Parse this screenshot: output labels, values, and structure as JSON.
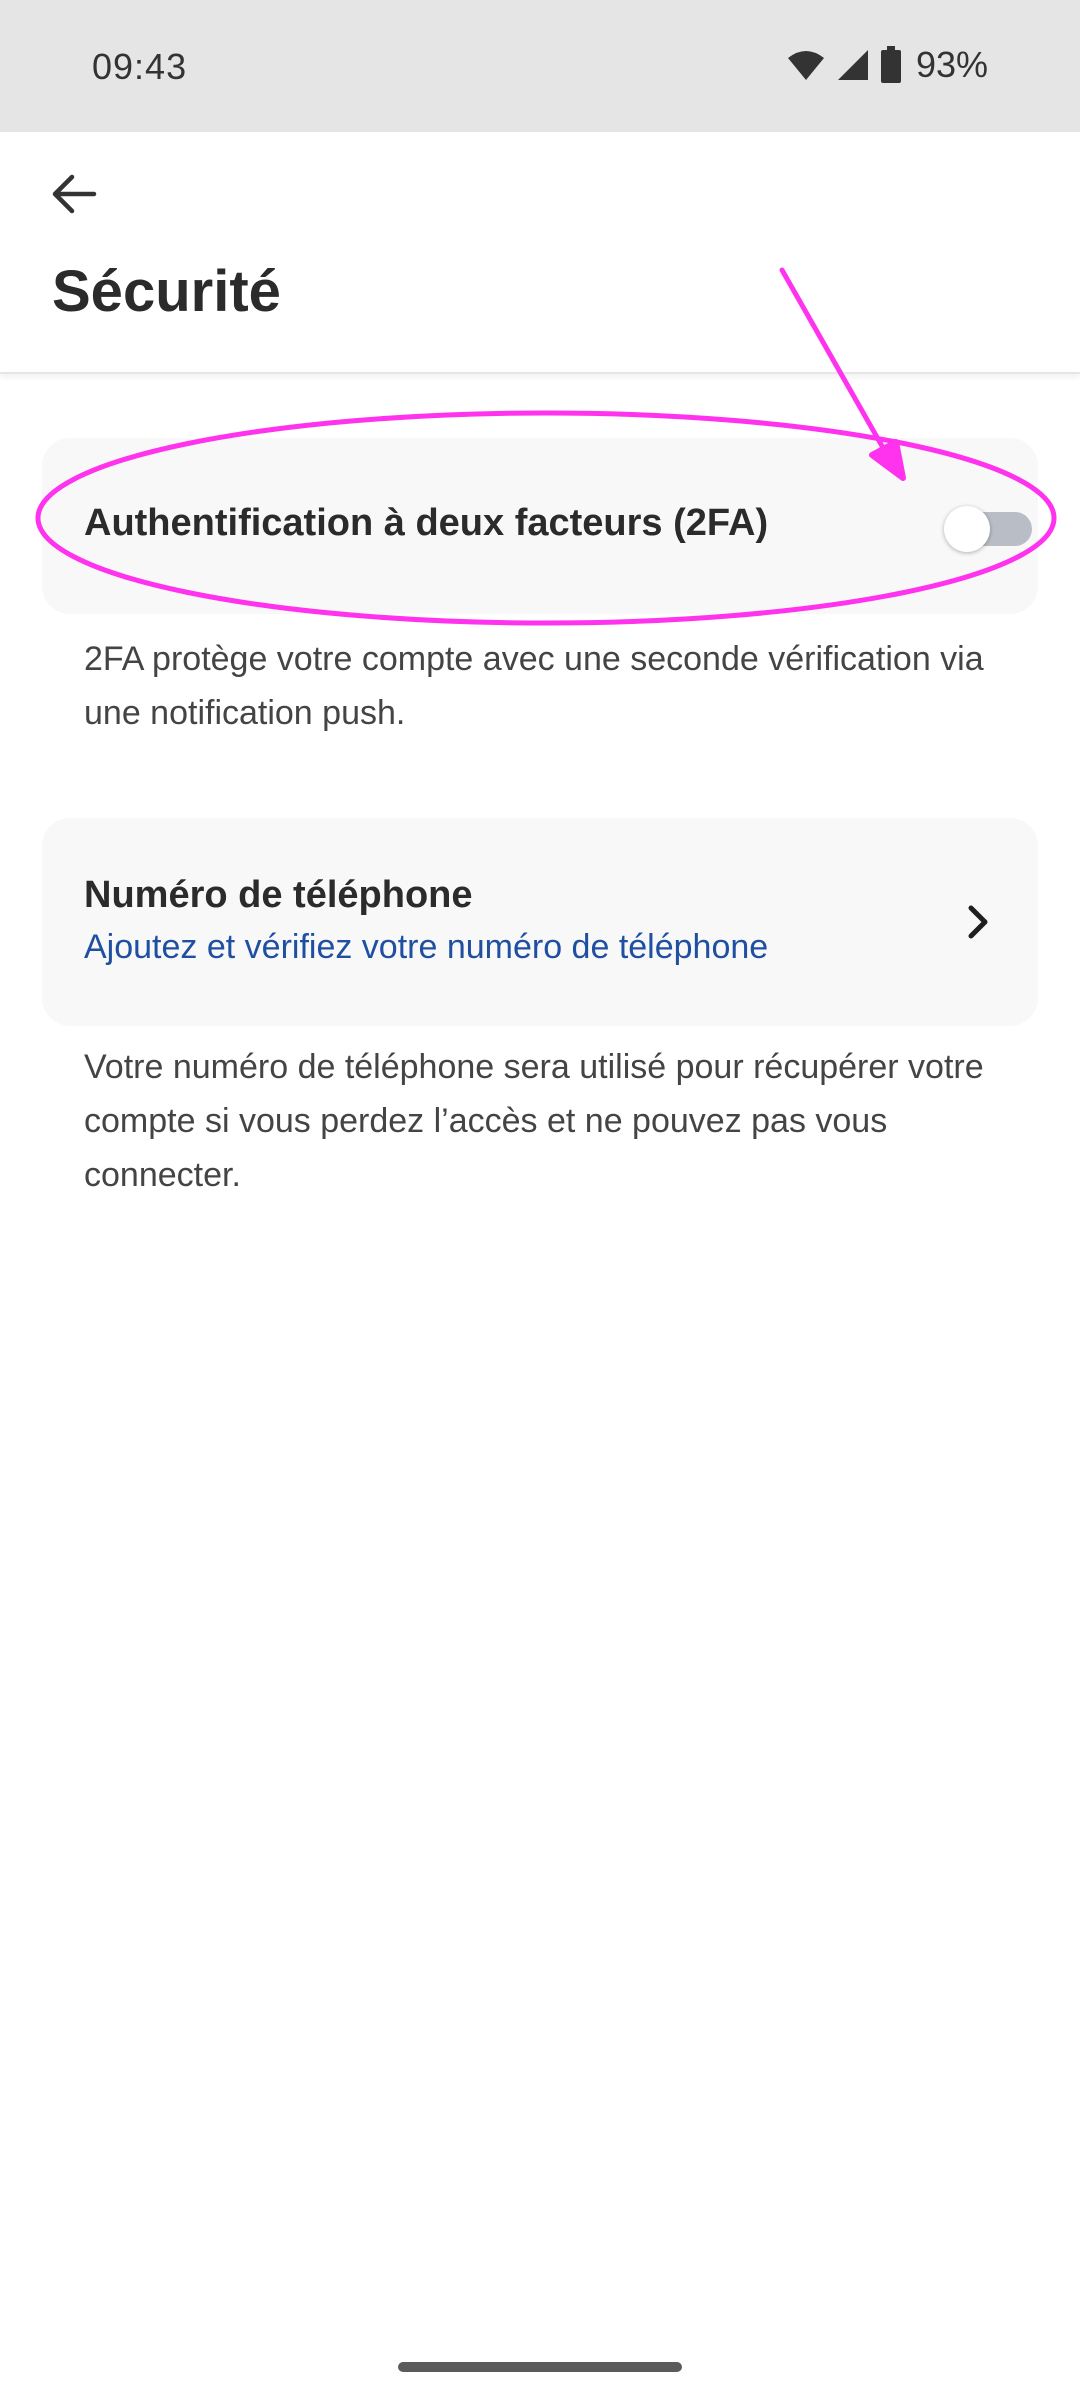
{
  "status_bar": {
    "time": "09:43",
    "battery": "93%",
    "icons": [
      "wifi-icon",
      "signal-icon",
      "battery-icon"
    ]
  },
  "header": {
    "back_icon": "arrow-left-icon",
    "title": "Sécurité"
  },
  "two_factor": {
    "label": "Authentification à deux facteurs (2FA)",
    "enabled": false,
    "helper": "2FA protège votre compte avec une seconde vérification via une notification push."
  },
  "phone": {
    "title": "Numéro de téléphone",
    "subtitle": "Ajoutez et vérifiez votre numéro de téléphone",
    "chevron_icon": "chevron-right-icon",
    "helper": "Votre numéro de téléphone sera utilisé pour récupérer votre compte si vous perdez l’accès et ne pouvez pas vous connecter."
  },
  "colors": {
    "status_bar_bg": "#e5e5e5",
    "card_bg": "#f8f8f8",
    "link_blue": "#1f4fa0",
    "toggle_off_track": "#b9bec6",
    "annotation_magenta": "#ff33ee"
  }
}
